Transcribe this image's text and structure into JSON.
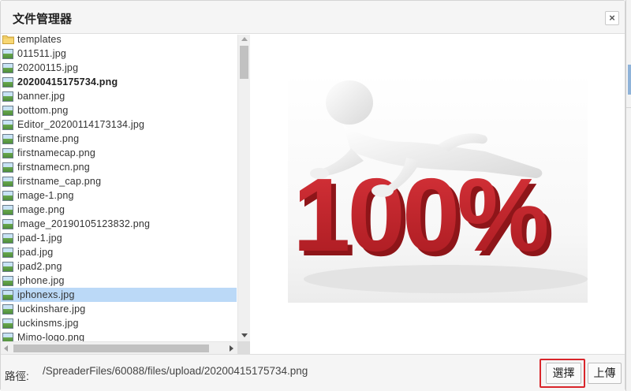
{
  "dialog": {
    "title": "文件管理器",
    "close_label": "×"
  },
  "files": [
    {
      "name": "templates",
      "type": "folder",
      "icon": "folder-icon"
    },
    {
      "name": "011511.jpg",
      "type": "image",
      "icon": "image-file-icon"
    },
    {
      "name": "20200115.jpg",
      "type": "image",
      "icon": "image-file-icon"
    },
    {
      "name": "20200415175734.png",
      "type": "image",
      "icon": "image-file-icon",
      "bold": true
    },
    {
      "name": "banner.jpg",
      "type": "image",
      "icon": "image-file-icon"
    },
    {
      "name": "bottom.png",
      "type": "image",
      "icon": "image-file-icon"
    },
    {
      "name": "Editor_20200114173134.jpg",
      "type": "image",
      "icon": "image-file-icon"
    },
    {
      "name": "firstname.png",
      "type": "image",
      "icon": "image-file-icon"
    },
    {
      "name": "firstnamecap.png",
      "type": "image",
      "icon": "image-file-icon"
    },
    {
      "name": "firstnamecn.png",
      "type": "image",
      "icon": "image-file-icon"
    },
    {
      "name": "firstname_cap.png",
      "type": "image",
      "icon": "image-file-icon"
    },
    {
      "name": "image-1.png",
      "type": "image",
      "icon": "image-file-icon"
    },
    {
      "name": "image.png",
      "type": "image",
      "icon": "image-file-icon"
    },
    {
      "name": "Image_20190105123832.png",
      "type": "image",
      "icon": "image-file-icon"
    },
    {
      "name": "ipad-1.jpg",
      "type": "image",
      "icon": "image-file-icon"
    },
    {
      "name": "ipad.jpg",
      "type": "image",
      "icon": "image-file-icon"
    },
    {
      "name": "ipad2.png",
      "type": "image",
      "icon": "image-file-icon"
    },
    {
      "name": "iphone.jpg",
      "type": "image",
      "icon": "image-file-icon"
    },
    {
      "name": "iphonexs.jpg",
      "type": "image",
      "icon": "image-file-icon",
      "selected": true
    },
    {
      "name": "luckinshare.jpg",
      "type": "image",
      "icon": "image-file-icon"
    },
    {
      "name": "luckinsms.jpg",
      "type": "image",
      "icon": "image-file-icon"
    },
    {
      "name": "Mimo-logo.png",
      "type": "image",
      "icon": "image-file-icon"
    }
  ],
  "preview": {
    "text": "100%",
    "colors": {
      "red": "#c8262c",
      "figure": "#f2f2f2"
    }
  },
  "footer": {
    "path_label": "路徑:",
    "path_value": "/SpreaderFiles/60088/files/upload/20200415175734.png",
    "select_label": "選擇",
    "upload_label": "上傳"
  },
  "colors": {
    "selection": "#bbd9f7",
    "highlight": "#d9262b",
    "titlebar": "#f5f5f5"
  }
}
